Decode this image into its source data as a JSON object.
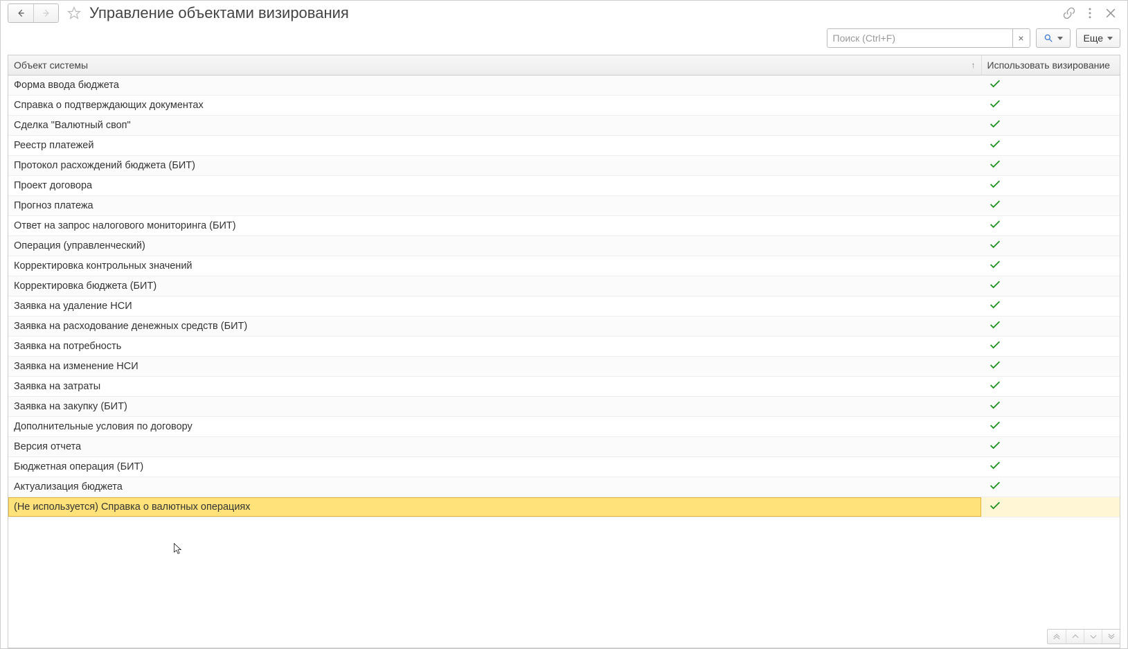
{
  "header": {
    "title": "Управление объектами визирования"
  },
  "toolbar": {
    "search_placeholder": "Поиск (Ctrl+F)",
    "more_label": "Еще"
  },
  "table": {
    "columns": {
      "object": "Объект системы",
      "use": "Использовать визирование"
    },
    "rows": [
      {
        "name": "Форма ввода бюджета",
        "use": true
      },
      {
        "name": "Справка о подтверждающих документах",
        "use": true
      },
      {
        "name": "Сделка \"Валютный своп\"",
        "use": true
      },
      {
        "name": "Реестр платежей",
        "use": true
      },
      {
        "name": "Протокол расхождений бюджета (БИТ)",
        "use": true
      },
      {
        "name": "Проект договора",
        "use": true
      },
      {
        "name": "Прогноз платежа",
        "use": true
      },
      {
        "name": "Ответ на запрос налогового мониторинга (БИТ)",
        "use": true
      },
      {
        "name": "Операция (управленческий)",
        "use": true
      },
      {
        "name": "Корректировка контрольных значений",
        "use": true
      },
      {
        "name": "Корректировка бюджета (БИТ)",
        "use": true
      },
      {
        "name": "Заявка на удаление НСИ",
        "use": true
      },
      {
        "name": "Заявка на расходование денежных средств (БИТ)",
        "use": true
      },
      {
        "name": "Заявка на потребность",
        "use": true
      },
      {
        "name": "Заявка на изменение НСИ",
        "use": true
      },
      {
        "name": "Заявка на затраты",
        "use": true
      },
      {
        "name": "Заявка на закупку (БИТ)",
        "use": true
      },
      {
        "name": "Дополнительные условия по договору",
        "use": true
      },
      {
        "name": "Версия отчета",
        "use": true
      },
      {
        "name": "Бюджетная операция (БИТ)",
        "use": true
      },
      {
        "name": "Актуализация бюджета",
        "use": true
      },
      {
        "name": "(Не используется) Справка о валютных операциях",
        "use": true,
        "selected": true
      }
    ]
  }
}
